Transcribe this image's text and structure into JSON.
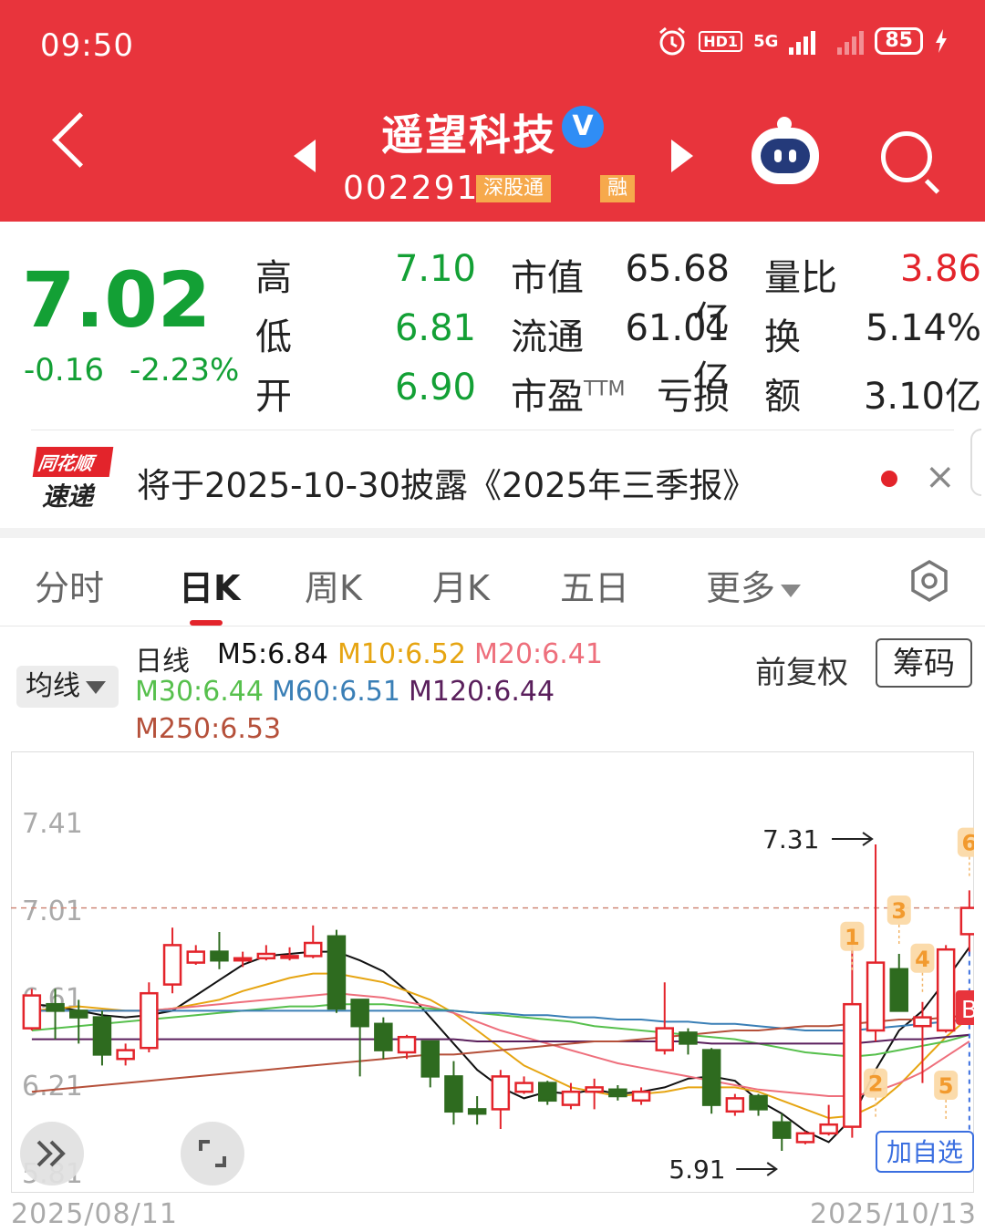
{
  "status_bar": {
    "time": "09:50",
    "network": "5G",
    "hd_label": "HD1",
    "battery": "85"
  },
  "header": {
    "stock_name": "遥望科技",
    "verified_mark": "V",
    "stock_code": "002291",
    "tag_connect": "深股通",
    "tag_margin": "融"
  },
  "quote": {
    "price": "7.02",
    "change": "-0.16",
    "change_pct": "-2.23%",
    "high_label": "高",
    "high": "7.10",
    "low_label": "低",
    "low": "6.81",
    "open_label": "开",
    "open": "6.90",
    "mcap_label": "市值",
    "mcap": "65.68亿",
    "float_label": "流通",
    "float": "61.01亿",
    "pe_label": "市盈",
    "pe_sup": "TTM",
    "pe": "亏损",
    "vol_ratio_label": "量比",
    "vol_ratio": "3.86",
    "turnover_label": "换",
    "turnover": "5.14%",
    "amount_label": "额",
    "amount": "3.10亿"
  },
  "news": {
    "logo_top": "同花顺",
    "logo_bottom": "速递",
    "text": "将于2025-10-30披露《2025年三季报》"
  },
  "tabs": [
    {
      "label": "分时",
      "active": false
    },
    {
      "label": "日K",
      "active": true
    },
    {
      "label": "周K",
      "active": false
    },
    {
      "label": "月K",
      "active": false
    },
    {
      "label": "五日",
      "active": false
    },
    {
      "label": "更多",
      "active": false
    }
  ],
  "ma_legend": {
    "selector": "均线",
    "period": "日线",
    "items": [
      {
        "label": "M5:6.84",
        "color": "#111111"
      },
      {
        "label": "M10:6.52",
        "color": "#e6a512"
      },
      {
        "label": "M20:6.41",
        "color": "#ee6f7c"
      },
      {
        "label": "M30:6.44",
        "color": "#57c04d"
      },
      {
        "label": "M60:6.51",
        "color": "#3a7fb6"
      },
      {
        "label": "M120:6.44",
        "color": "#5a1f5c"
      },
      {
        "label": "M250:6.53",
        "color": "#b5503a"
      }
    ],
    "adjust": "前复权",
    "chips": "筹码"
  },
  "chart_data": {
    "type": "candlestick",
    "x_range": [
      "2025/08/11",
      "2025/10/13"
    ],
    "ylim": [
      5.81,
      7.61
    ],
    "y_ticks": [
      "7.41",
      "7.01",
      "6.61",
      "6.21",
      "5.81"
    ],
    "current_price_line": 7.02,
    "colors": {
      "up": "#e3242b",
      "down": "#2e6b1f"
    },
    "candles": [
      {
        "o": 6.47,
        "c": 6.62,
        "h": 6.65,
        "l": 6.46
      },
      {
        "o": 6.58,
        "c": 6.55,
        "h": 6.65,
        "l": 6.42
      },
      {
        "o": 6.55,
        "c": 6.52,
        "h": 6.6,
        "l": 6.4
      },
      {
        "o": 6.52,
        "c": 6.35,
        "h": 6.55,
        "l": 6.3
      },
      {
        "o": 6.33,
        "c": 6.37,
        "h": 6.4,
        "l": 6.3
      },
      {
        "o": 6.38,
        "c": 6.63,
        "h": 6.68,
        "l": 6.36
      },
      {
        "o": 6.67,
        "c": 6.85,
        "h": 6.93,
        "l": 6.63
      },
      {
        "o": 6.77,
        "c": 6.82,
        "h": 6.85,
        "l": 6.76
      },
      {
        "o": 6.82,
        "c": 6.78,
        "h": 6.91,
        "l": 6.74
      },
      {
        "o": 6.78,
        "c": 6.79,
        "h": 6.82,
        "l": 6.75
      },
      {
        "o": 6.79,
        "c": 6.81,
        "h": 6.85,
        "l": 6.78
      },
      {
        "o": 6.8,
        "c": 6.8,
        "h": 6.84,
        "l": 6.78
      },
      {
        "o": 6.8,
        "c": 6.86,
        "h": 6.94,
        "l": 6.79
      },
      {
        "o": 6.89,
        "c": 6.56,
        "h": 6.92,
        "l": 6.54
      },
      {
        "o": 6.6,
        "c": 6.48,
        "h": 6.6,
        "l": 6.25
      },
      {
        "o": 6.49,
        "c": 6.37,
        "h": 6.52,
        "l": 6.33
      },
      {
        "o": 6.36,
        "c": 6.43,
        "h": 6.44,
        "l": 6.33
      },
      {
        "o": 6.41,
        "c": 6.25,
        "h": 6.41,
        "l": 6.2
      },
      {
        "o": 6.25,
        "c": 6.09,
        "h": 6.32,
        "l": 6.03
      },
      {
        "o": 6.1,
        "c": 6.08,
        "h": 6.16,
        "l": 6.03
      },
      {
        "o": 6.1,
        "c": 6.25,
        "h": 6.28,
        "l": 6.01
      },
      {
        "o": 6.18,
        "c": 6.22,
        "h": 6.25,
        "l": 6.17
      },
      {
        "o": 6.22,
        "c": 6.14,
        "h": 6.23,
        "l": 6.12
      },
      {
        "o": 6.12,
        "c": 6.18,
        "h": 6.22,
        "l": 6.1
      },
      {
        "o": 6.18,
        "c": 6.2,
        "h": 6.24,
        "l": 6.1
      },
      {
        "o": 6.19,
        "c": 6.16,
        "h": 6.21,
        "l": 6.14
      },
      {
        "o": 6.14,
        "c": 6.18,
        "h": 6.2,
        "l": 6.12
      },
      {
        "o": 6.37,
        "c": 6.47,
        "h": 6.68,
        "l": 6.35
      },
      {
        "o": 6.45,
        "c": 6.4,
        "h": 6.47,
        "l": 6.35
      },
      {
        "o": 6.37,
        "c": 6.12,
        "h": 6.38,
        "l": 6.08
      },
      {
        "o": 6.09,
        "c": 6.15,
        "h": 6.17,
        "l": 6.07
      },
      {
        "o": 6.16,
        "c": 6.1,
        "h": 6.17,
        "l": 6.07
      },
      {
        "o": 6.04,
        "c": 5.97,
        "h": 6.08,
        "l": 5.91
      },
      {
        "o": 5.95,
        "c": 5.99,
        "h": 6.0,
        "l": 5.94
      },
      {
        "o": 5.99,
        "c": 6.03,
        "h": 6.12,
        "l": 5.98
      },
      {
        "o": 6.02,
        "c": 6.58,
        "h": 6.89,
        "l": 5.97
      },
      {
        "o": 6.46,
        "c": 6.77,
        "h": 7.31,
        "l": 6.41
      },
      {
        "o": 6.74,
        "c": 6.55,
        "h": 6.81,
        "l": 6.55
      },
      {
        "o": 6.48,
        "c": 6.52,
        "h": 6.59,
        "l": 6.22
      },
      {
        "o": 6.46,
        "c": 6.83,
        "h": 6.85,
        "l": 6.45
      },
      {
        "o": 6.9,
        "c": 7.02,
        "h": 7.1,
        "l": 6.81
      }
    ],
    "ma_lines": [
      {
        "name": "M5",
        "color": "#111111",
        "values": [
          6.58,
          6.57,
          6.55,
          6.53,
          6.52,
          6.53,
          6.55,
          6.62,
          6.69,
          6.76,
          6.8,
          6.81,
          6.82,
          6.82,
          6.78,
          6.73,
          6.64,
          6.52,
          6.4,
          6.28,
          6.2,
          6.15,
          6.18,
          6.17,
          6.19,
          6.17,
          6.18,
          6.2,
          6.24,
          6.25,
          6.23,
          6.14,
          6.08,
          6.0,
          5.95,
          6.06,
          6.28,
          6.46,
          6.55,
          6.69,
          6.84
        ]
      },
      {
        "name": "M10",
        "color": "#e6a512",
        "values": [
          6.55,
          6.56,
          6.57,
          6.56,
          6.55,
          6.55,
          6.56,
          6.58,
          6.6,
          6.64,
          6.67,
          6.7,
          6.72,
          6.72,
          6.7,
          6.68,
          6.64,
          6.6,
          6.54,
          6.46,
          6.38,
          6.3,
          6.25,
          6.2,
          6.18,
          6.16,
          6.17,
          6.18,
          6.2,
          6.2,
          6.2,
          6.18,
          6.14,
          6.1,
          6.06,
          6.07,
          6.12,
          6.21,
          6.32,
          6.43,
          6.52
        ]
      },
      {
        "name": "M20",
        "color": "#ee6f7c",
        "values": [
          6.55,
          6.55,
          6.55,
          6.55,
          6.55,
          6.55,
          6.56,
          6.57,
          6.58,
          6.59,
          6.6,
          6.61,
          6.62,
          6.63,
          6.62,
          6.61,
          6.59,
          6.57,
          6.54,
          6.5,
          6.46,
          6.43,
          6.4,
          6.37,
          6.34,
          6.31,
          6.29,
          6.27,
          6.25,
          6.23,
          6.21,
          6.19,
          6.18,
          6.17,
          6.16,
          6.16,
          6.18,
          6.22,
          6.27,
          6.34,
          6.41
        ]
      },
      {
        "name": "M30",
        "color": "#57c04d",
        "values": [
          6.46,
          6.47,
          6.48,
          6.49,
          6.5,
          6.51,
          6.52,
          6.53,
          6.54,
          6.55,
          6.56,
          6.57,
          6.57,
          6.58,
          6.58,
          6.58,
          6.57,
          6.56,
          6.55,
          6.54,
          6.53,
          6.52,
          6.51,
          6.5,
          6.48,
          6.47,
          6.46,
          6.45,
          6.44,
          6.43,
          6.42,
          6.4,
          6.38,
          6.36,
          6.35,
          6.34,
          6.35,
          6.37,
          6.39,
          6.41,
          6.44
        ]
      },
      {
        "name": "M60",
        "color": "#3a7fb6",
        "values": [
          6.55,
          6.55,
          6.55,
          6.55,
          6.55,
          6.55,
          6.55,
          6.55,
          6.55,
          6.55,
          6.55,
          6.55,
          6.55,
          6.55,
          6.55,
          6.55,
          6.55,
          6.55,
          6.55,
          6.54,
          6.54,
          6.53,
          6.53,
          6.52,
          6.52,
          6.51,
          6.51,
          6.5,
          6.5,
          6.49,
          6.49,
          6.48,
          6.47,
          6.46,
          6.46,
          6.46,
          6.47,
          6.48,
          6.49,
          6.5,
          6.51
        ]
      },
      {
        "name": "M120",
        "color": "#5a1f5c",
        "values": [
          6.42,
          6.42,
          6.42,
          6.42,
          6.42,
          6.42,
          6.42,
          6.42,
          6.42,
          6.42,
          6.42,
          6.42,
          6.42,
          6.42,
          6.42,
          6.42,
          6.42,
          6.42,
          6.42,
          6.41,
          6.41,
          6.41,
          6.41,
          6.41,
          6.41,
          6.41,
          6.41,
          6.41,
          6.41,
          6.4,
          6.4,
          6.4,
          6.4,
          6.4,
          6.4,
          6.4,
          6.41,
          6.42,
          6.42,
          6.43,
          6.44
        ]
      },
      {
        "name": "M250",
        "color": "#b5503a",
        "values": [
          6.18,
          6.19,
          6.2,
          6.21,
          6.22,
          6.23,
          6.24,
          6.25,
          6.26,
          6.27,
          6.28,
          6.29,
          6.3,
          6.31,
          6.32,
          6.33,
          6.34,
          6.35,
          6.35,
          6.36,
          6.37,
          6.38,
          6.39,
          6.4,
          6.41,
          6.41,
          6.42,
          6.43,
          6.44,
          6.45,
          6.46,
          6.46,
          6.47,
          6.48,
          6.48,
          6.49,
          6.5,
          6.51,
          6.51,
          6.52,
          6.53
        ]
      }
    ],
    "annotations": [
      {
        "text": "7.31",
        "value": 7.31,
        "index": 36,
        "kind": "high"
      },
      {
        "text": "5.91",
        "value": 5.91,
        "index": 32,
        "kind": "low"
      }
    ],
    "signals": [
      {
        "text": "1",
        "index": 35,
        "value": 6.89
      },
      {
        "text": "2",
        "index": 36,
        "value": 6.22
      },
      {
        "text": "3",
        "index": 37,
        "value": 7.01
      },
      {
        "text": "4",
        "index": 38,
        "value": 6.79
      },
      {
        "text": "5",
        "index": 39,
        "value": 6.21
      },
      {
        "text": "6",
        "index": 40,
        "value": 7.32
      }
    ],
    "buy_marker": {
      "text": "B",
      "index": 40,
      "value": 6.56
    }
  },
  "chart_ui": {
    "date_start": "2025/08/11",
    "date_end": "2025/10/13",
    "add_watchlist": "加自选"
  }
}
